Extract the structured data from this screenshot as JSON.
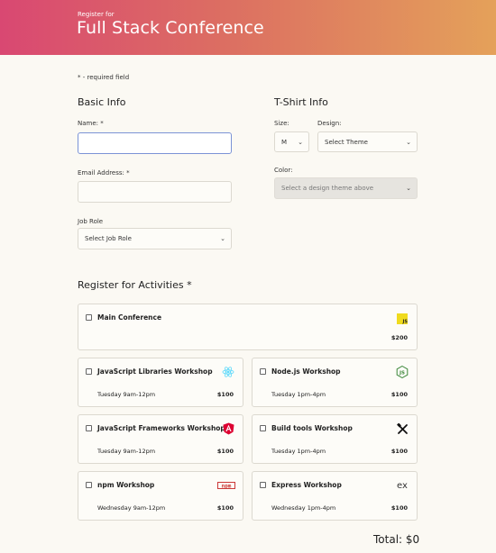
{
  "header": {
    "subtitle": "Register for",
    "title": "Full Stack Conference"
  },
  "required_note": "* - required field",
  "basic_info": {
    "title": "Basic Info",
    "name_label": "Name: *",
    "name_value": "",
    "email_label": "Email Address: *",
    "email_value": "",
    "job_role_label": "Job Role",
    "job_role_value": "Select Job Role"
  },
  "tshirt": {
    "title": "T-Shirt Info",
    "size_label": "Size:",
    "size_value": "M",
    "design_label": "Design:",
    "design_value": "Select Theme",
    "color_label": "Color:",
    "color_value": "Select a design theme above"
  },
  "activities": {
    "title": "Register for Activities *",
    "items": [
      {
        "name": "Main Conference",
        "time": "",
        "price": "$200",
        "icon": "javascript-icon"
      },
      {
        "name": "JavaScript Libraries Workshop",
        "time": "Tuesday 9am-12pm",
        "price": "$100",
        "icon": "react-icon"
      },
      {
        "name": "Node.js Workshop",
        "time": "Tuesday 1pm-4pm",
        "price": "$100",
        "icon": "nodejs-icon"
      },
      {
        "name": "JavaScript Frameworks Workshop",
        "time": "Tuesday 9am-12pm",
        "price": "$100",
        "icon": "angular-icon"
      },
      {
        "name": "Build tools Workshop",
        "time": "Tuesday 1pm-4pm",
        "price": "$100",
        "icon": "build-tools-icon"
      },
      {
        "name": "npm Workshop",
        "time": "Wednesday 9am-12pm",
        "price": "$100",
        "icon": "npm-icon"
      },
      {
        "name": "Express Workshop",
        "time": "Wednesday 1pm-4pm",
        "price": "$100",
        "icon": "express-icon"
      }
    ]
  },
  "total": "Total: $0",
  "icon_texts": {
    "js": "JS",
    "npm": "npm",
    "express": "ex"
  },
  "colors": {
    "header_start": "#d94872",
    "header_end": "#e4a15a",
    "focus_border": "#7b93d6",
    "js_yellow": "#f0db1e",
    "angular_red": "#dd0031",
    "node_green": "#3c873a",
    "react_blue": "#61dafb",
    "npm_red": "#cb3837"
  }
}
